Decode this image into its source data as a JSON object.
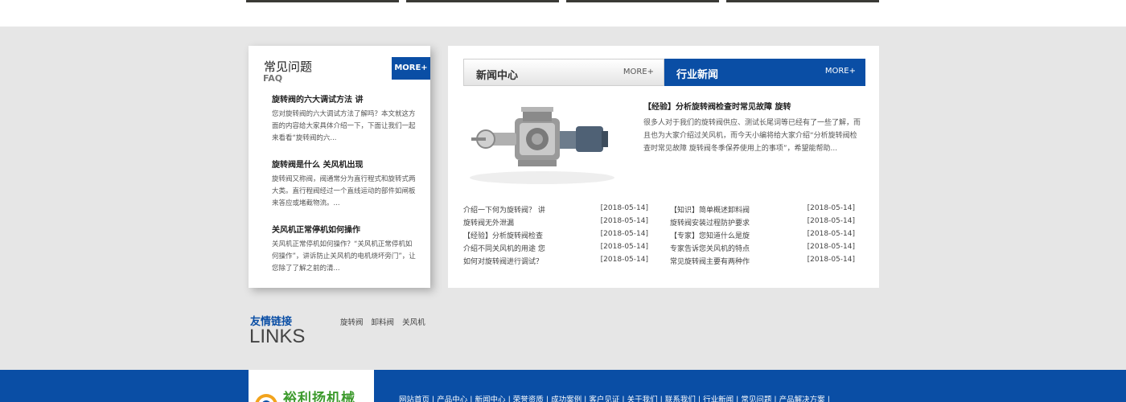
{
  "faq": {
    "title": "常见问题",
    "subtitle": "FAQ",
    "more": "MORE+",
    "items": [
      {
        "title": "旋转阀的六大调试方法 讲",
        "desc": "您对旋转阀的六大调试方法了解吗？本文就这方面的内容给大家具体介绍一下，下面让我们一起来看看“旋转阀的六..."
      },
      {
        "title": "旋转阀是什么 关风机出现",
        "desc": "旋转阀又称阀，阀通常分为直行程式和旋转式两大类。直行程阀经过一个直线运动的部件如闸板来答应或堵截物流。..."
      },
      {
        "title": "关风机正常停机如何操作",
        "desc": "关风机正常停机如何操作？“关风机正常停机如何操作”，讲诉防止关风机的电机烧坏旁门”，让您除了了解之前的清..."
      }
    ]
  },
  "news": {
    "tab_left": {
      "title": "新闻中心",
      "more": "MORE+"
    },
    "tab_right": {
      "title": "行业新闻",
      "more": "MORE+"
    },
    "featured": {
      "title": "【经验】分析旋转阀检查时常见故障 旋转",
      "desc": "很多人对于我们的旋转阀供应、测试长尾词等已经有了一些了解，而且也为大家介绍过关风机，而今天小编将给大家介绍“分析旋转阀检查时常见故障 旋转阀冬季保养使用上的事项”，希望能帮助..."
    },
    "left_list": [
      {
        "title": "介绍一下何为旋转阀？ 讲",
        "date": "[2018-05-14]"
      },
      {
        "title": "旋转阀无外泄漏",
        "date": "[2018-05-14]"
      },
      {
        "title": "【经验】分析旋转阀检查",
        "date": "[2018-05-14]"
      },
      {
        "title": "介绍不同关风机的用途 您",
        "date": "[2018-05-14]"
      },
      {
        "title": "如何对旋转阀进行调试？",
        "date": "[2018-05-14]"
      }
    ],
    "right_list": [
      {
        "title": "【知识】简单概述卸料阀",
        "date": "[2018-05-14]"
      },
      {
        "title": "旋转阀安装过程防护要求",
        "date": "[2018-05-14]"
      },
      {
        "title": "【专家】您知道什么是旋",
        "date": "[2018-05-14]"
      },
      {
        "title": "专家告诉您关风机的特点",
        "date": "[2018-05-14]"
      },
      {
        "title": "常见旋转阀主要有两种作",
        "date": "[2018-05-14]"
      }
    ]
  },
  "links": {
    "title": "友情链接",
    "subtitle": "LINKS",
    "items": [
      "旋转阀",
      "卸料阀",
      "关风机"
    ]
  },
  "footer": {
    "logo_text": "裕利扬机械",
    "nav": [
      "网站首页",
      "产品中心",
      "新闻中心",
      "荣誉资质",
      "成功案例",
      "客户见证",
      "关于我们",
      "联系我们",
      "行业新闻",
      "常见问题",
      "产品解决方案"
    ]
  },
  "colors": {
    "accent": "#0a4ea5",
    "logo_green": "#3c9a2c"
  }
}
